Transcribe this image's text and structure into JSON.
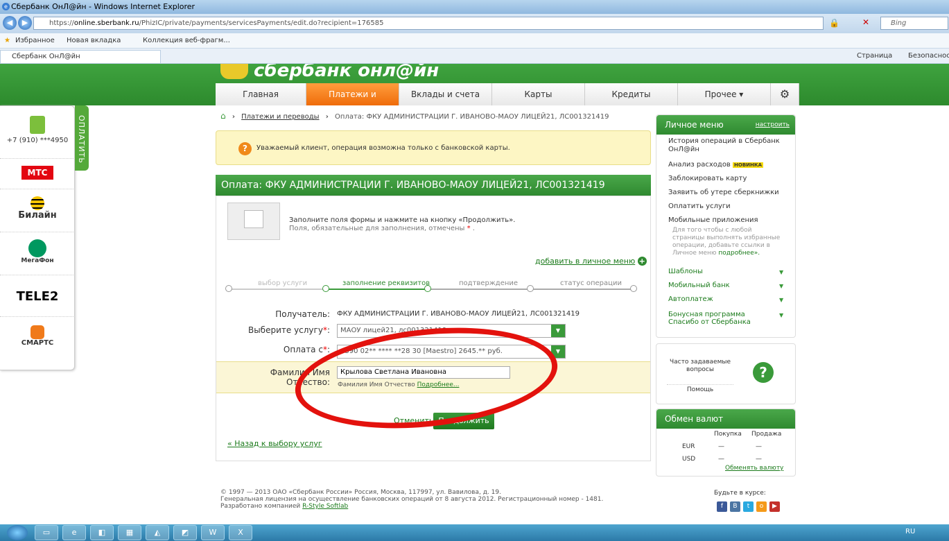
{
  "window": {
    "title": "Сбербанк ОнЛ@йн - Windows Internet Explorer"
  },
  "browser": {
    "url_prefix": "https://",
    "url_host": "online.sberbank.ru",
    "url_path": "/PhizIC/private/payments/servicesPayments/edit.do?recipient=176585",
    "search_placeholder": "Bing",
    "favorites": "Избранное",
    "fav_new_tab": "Новая вкладка",
    "fav_gallery": "Коллекция веб-фрагм...",
    "tab_title": "Сбербанк ОнЛ@йн",
    "cmd_page": "Страница",
    "cmd_security": "Безопасность"
  },
  "logo": {
    "text": "сбербанк онл@йн"
  },
  "nav": {
    "items": [
      "Главная",
      "Платежи и переводы",
      "Вклады и счета",
      "Карты",
      "Кредиты",
      "Прочее ▾"
    ],
    "active_index": 1
  },
  "left_widget": {
    "paytab": "ОПЛАТИТЬ",
    "phone": "+7 (910) ***4950",
    "operators": [
      "МТС",
      "Билайн",
      "МегаФон",
      "TELE2",
      "СМАРТС"
    ]
  },
  "breadcrumb": {
    "link": "Платежи и переводы",
    "current": "Оплата: ФКУ АДМИНИСТРАЦИИ Г. ИВАНОВО-МАОУ ЛИЦЕЙ21, ЛС001321419"
  },
  "warning": {
    "text": "Уважаемый клиент, операция возможна только с банковской карты."
  },
  "form": {
    "title": "Оплата: ФКУ АДМИНИСТРАЦИИ Г. ИВАНОВО-МАОУ ЛИЦЕЙ21, ЛС001321419",
    "intro": "Заполните поля формы и нажмите на кнопку «Продолжить».",
    "required_note": "Поля, обязательные для заполнения, отмечены",
    "add_to_menu": "добавить в личное меню",
    "steps": [
      "выбор услуги",
      "заполнение реквизитов",
      "подтверждение",
      "статус операции"
    ],
    "recipient_label": "Получатель:",
    "recipient_value": "ФКУ АДМИНИСТРАЦИИ Г. ИВАНОВО-МАОУ ЛИЦЕЙ21, ЛС001321419",
    "service_label": "Выберите услугу",
    "service_value": "МАОУ лицей21, лс001321419",
    "payfrom_label": "Оплата с",
    "payfrom_value": "6390 02** **** **28 30 [Maestro] 2645.** руб.",
    "fio_label": "Фамилия Имя Отчество:",
    "fio_value": "Крылова Светлана Ивановна",
    "fio_hint": "Фамилия Имя Отчество",
    "fio_more": "Подробнее...",
    "cancel": "Отменить",
    "continue": "Продолжить",
    "back": "« Назад к выбору услуг"
  },
  "personal_menu": {
    "title": "Личное меню",
    "configure": "настроить",
    "items": [
      "История операций в Сбербанк ОнЛ@йн",
      "Анализ расходов",
      "Заблокировать карту",
      "Заявить об утере сберкнижки",
      "Оплатить услуги",
      "Мобильные приложения"
    ],
    "new_badge": "НОВИНКА",
    "hint": "Для того чтобы с любой страницы выполнять избранные операции, добавьте ссылки в Личное меню",
    "hint_more": "подробнее».",
    "sections": [
      "Шаблоны",
      "Мобильный банк",
      "Автоплатеж",
      "Бонусная программа Спасибо от Сбербанка"
    ]
  },
  "faq": {
    "text": "Часто задаваемые вопросы",
    "help": "Помощь"
  },
  "exchange": {
    "title": "Обмен валют",
    "buy": "Покупка",
    "sell": "Продажа",
    "rows": [
      {
        "cur": "EUR",
        "buy": "—",
        "sell": "—"
      },
      {
        "cur": "USD",
        "buy": "—",
        "sell": "—"
      }
    ],
    "link": "Обменять валюту"
  },
  "footer": {
    "line1": "© 1997 — 2013 ОАО «Сбербанк России» Россия, Москва, 117997, ул. Вавилова, д. 19.",
    "line2": "Генеральная лицензия на осуществление банковских операций от 8 августа 2012. Регистрационный номер - 1481.",
    "line3": "Разработано компанией",
    "dev": "R-Style Softlab",
    "social": "Будьте в курсе:"
  },
  "taskbar": {
    "lang": "RU"
  }
}
